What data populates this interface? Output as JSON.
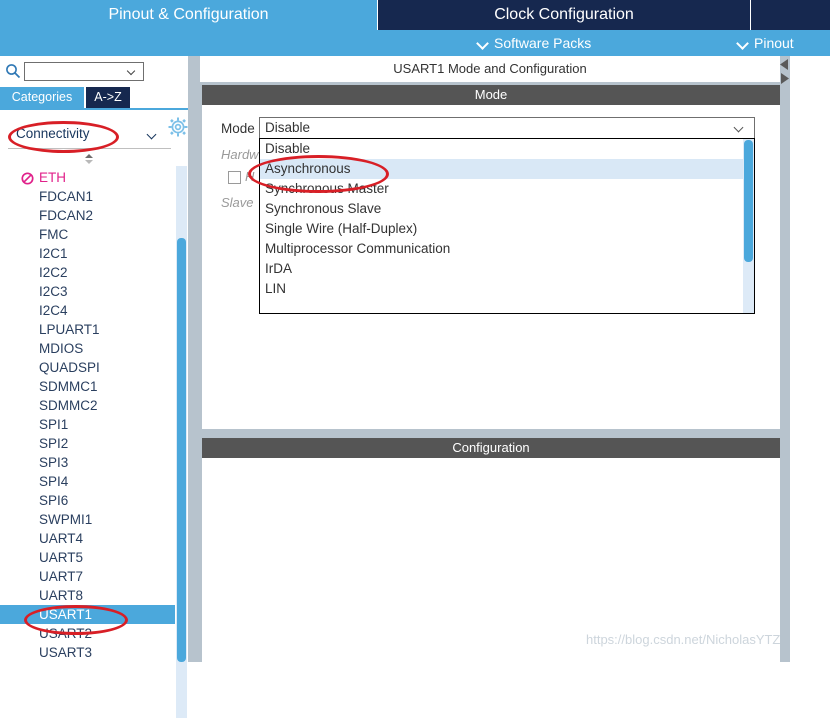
{
  "top_tabs": [
    {
      "label": "Pinout & Configuration",
      "active": true
    },
    {
      "label": "Clock Configuration",
      "active": false
    },
    {
      "label": "",
      "active": false
    }
  ],
  "subbar": {
    "software_packs": "Software Packs",
    "pinout": "Pinout"
  },
  "left_panel": {
    "search": {
      "value": "",
      "placeholder": "",
      "icon": "search-icon"
    },
    "gear_icon": "gear-icon",
    "tabs": [
      {
        "label": "Categories",
        "active": true
      },
      {
        "label": "A->Z",
        "active": false
      }
    ],
    "group": {
      "label": "Connectivity",
      "chevron_icon": "chevron-down-icon",
      "sorter_icon": "sort-updown-icon"
    },
    "peripherals": [
      {
        "label": "ETH",
        "blocked": true,
        "selected": false,
        "icon": "prohibited-icon"
      },
      {
        "label": "FDCAN1",
        "blocked": false,
        "selected": false
      },
      {
        "label": "FDCAN2",
        "blocked": false,
        "selected": false
      },
      {
        "label": "FMC",
        "blocked": false,
        "selected": false
      },
      {
        "label": "I2C1",
        "blocked": false,
        "selected": false
      },
      {
        "label": "I2C2",
        "blocked": false,
        "selected": false
      },
      {
        "label": "I2C3",
        "blocked": false,
        "selected": false
      },
      {
        "label": "I2C4",
        "blocked": false,
        "selected": false
      },
      {
        "label": "LPUART1",
        "blocked": false,
        "selected": false
      },
      {
        "label": "MDIOS",
        "blocked": false,
        "selected": false
      },
      {
        "label": "QUADSPI",
        "blocked": false,
        "selected": false
      },
      {
        "label": "SDMMC1",
        "blocked": false,
        "selected": false
      },
      {
        "label": "SDMMC2",
        "blocked": false,
        "selected": false
      },
      {
        "label": "SPI1",
        "blocked": false,
        "selected": false
      },
      {
        "label": "SPI2",
        "blocked": false,
        "selected": false
      },
      {
        "label": "SPI3",
        "blocked": false,
        "selected": false
      },
      {
        "label": "SPI4",
        "blocked": false,
        "selected": false
      },
      {
        "label": "SPI6",
        "blocked": false,
        "selected": false
      },
      {
        "label": "SWPMI1",
        "blocked": false,
        "selected": false
      },
      {
        "label": "UART4",
        "blocked": false,
        "selected": false
      },
      {
        "label": "UART5",
        "blocked": false,
        "selected": false
      },
      {
        "label": "UART7",
        "blocked": false,
        "selected": false
      },
      {
        "label": "UART8",
        "blocked": false,
        "selected": false
      },
      {
        "label": "USART1",
        "blocked": false,
        "selected": true
      },
      {
        "label": "USART2",
        "blocked": false,
        "selected": false
      },
      {
        "label": "USART3",
        "blocked": false,
        "selected": false
      }
    ]
  },
  "main_panel": {
    "title": "USART1 Mode and Configuration",
    "mode_section_header": "Mode",
    "config_section_header": "Configuration",
    "mode_label": "Mode",
    "mode_selected_value": "Disable",
    "mode_options": [
      {
        "label": "Disable",
        "highlighted": false
      },
      {
        "label": "Asynchronous",
        "highlighted": true
      },
      {
        "label": "Synchronous Master",
        "highlighted": false
      },
      {
        "label": "Synchronous Slave",
        "highlighted": false
      },
      {
        "label": "Single Wire (Half-Duplex)",
        "highlighted": false
      },
      {
        "label": "Multiprocessor Communication",
        "highlighted": false
      },
      {
        "label": "IrDA",
        "highlighted": false
      },
      {
        "label": "LIN",
        "highlighted": false
      }
    ],
    "background_labels": {
      "hardware": "Hardw",
      "hardware_flow": "H",
      "slave": "Slave"
    },
    "collapse_arrows": [
      "collapse-left-icon",
      "collapse-right-icon"
    ]
  },
  "watermark": "https://blog.csdn.net/NicholasYTZ",
  "colors": {
    "accent_blue": "#4ba8dc",
    "dark_navy": "#16284f",
    "section_gray": "#555555",
    "panel_gray": "#b7c3cd",
    "blocked_magenta": "#e0218a",
    "annotation_red": "#d81f26",
    "highlight_row": "#d9e8f6"
  }
}
